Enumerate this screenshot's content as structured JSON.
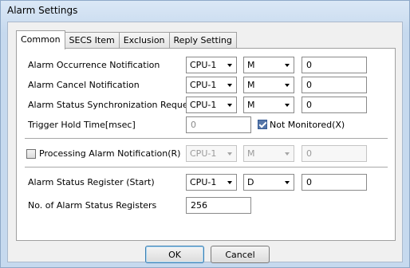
{
  "window": {
    "title": "Alarm Settings"
  },
  "tabs": [
    {
      "label": "Common"
    },
    {
      "label": "SECS Item"
    },
    {
      "label": "Exclusion"
    },
    {
      "label": "Reply Setting"
    }
  ],
  "rows": {
    "occurrence": {
      "label": "Alarm Occurrence Notification",
      "cpu": "CPU-1",
      "device": "M",
      "value": "0"
    },
    "cancel": {
      "label": "Alarm Cancel Notification",
      "cpu": "CPU-1",
      "device": "M",
      "value": "0"
    },
    "sync": {
      "label": "Alarm Status Synchronization Request",
      "cpu": "CPU-1",
      "device": "M",
      "value": "0"
    },
    "trigger": {
      "label": "Trigger Hold Time[msec]",
      "value": "0",
      "not_monitored_label": "Not Monitored(X)",
      "not_monitored_checked": true
    },
    "processing": {
      "label": "Processing Alarm Notification(R)",
      "checked": false,
      "cpu": "CPU-1",
      "device": "M",
      "value": "0"
    },
    "status_register": {
      "label": "Alarm Status Register (Start)",
      "cpu": "CPU-1",
      "device": "D",
      "value": "0"
    },
    "num_registers": {
      "label": "No. of Alarm Status Registers",
      "value": "256"
    }
  },
  "buttons": {
    "ok": "OK",
    "cancel": "Cancel"
  }
}
